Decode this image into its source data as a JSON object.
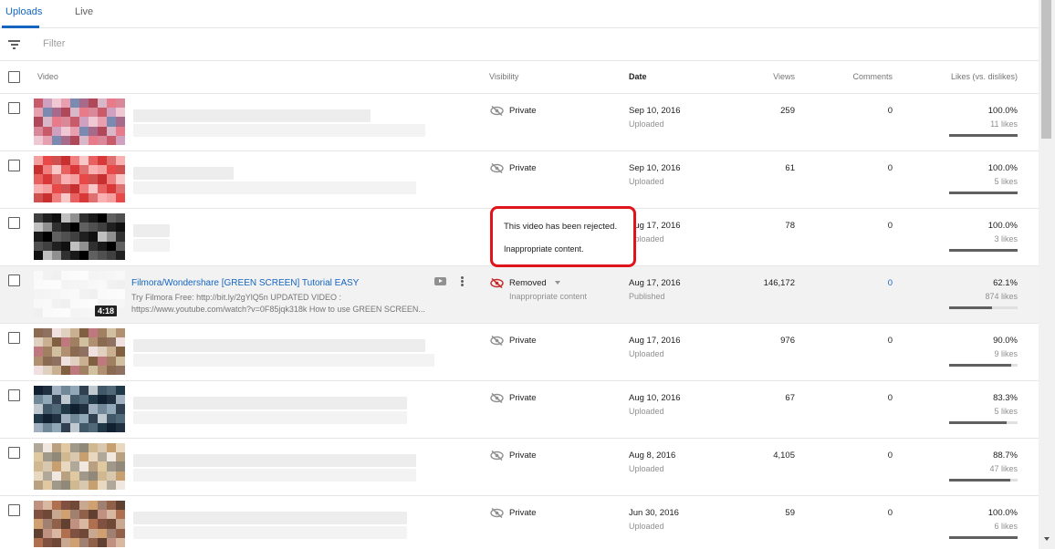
{
  "tabs": {
    "uploads": "Uploads",
    "live": "Live"
  },
  "filter": {
    "placeholder": "Filter"
  },
  "columns": {
    "video": "Video",
    "visibility": "Visibility",
    "date": "Date",
    "views": "Views",
    "comments": "Comments",
    "likes": "Likes (vs. dislikes)"
  },
  "tooltip": {
    "line1": "This video has been rejected.",
    "line2": "Inappropriate content."
  },
  "colors": {
    "accent": "#1565c0",
    "alert_border": "#e0141c",
    "removed_icon": "#c62828"
  },
  "rows": [
    {
      "visibility": "Private",
      "date": "Sep 10, 2016",
      "date_status": "Uploaded",
      "views": "259",
      "comments": "0",
      "likes_pct": "100.0%",
      "likes_count": "11 likes",
      "like_ratio": 1.0
    },
    {
      "visibility": "Private",
      "date": "Sep 10, 2016",
      "date_status": "Uploaded",
      "views": "61",
      "comments": "0",
      "likes_pct": "100.0%",
      "likes_count": "5 likes",
      "like_ratio": 1.0
    },
    {
      "visibility": "",
      "date": "Aug 17, 2016",
      "date_status": "Uploaded",
      "views": "78",
      "comments": "0",
      "likes_pct": "100.0%",
      "likes_count": "3 likes",
      "like_ratio": 1.0
    },
    {
      "title": "Filmora/Wondershare [GREEN SCREEN] Tutorial EASY",
      "description": "Try Filmora Free: http://bit.ly/2gYlQ5n UPDATED VIDEO :\nhttps://www.youtube.com/watch?v=0F85jqk318k How to use GREEN SCREEN...",
      "duration": "4:18",
      "visibility": "Removed",
      "visibility_note": "Inappropriate content",
      "date": "Aug 17, 2016",
      "date_status": "Published",
      "views": "146,172",
      "comments": "0",
      "likes_pct": "62.1%",
      "likes_count": "874 likes",
      "like_ratio": 0.621
    },
    {
      "visibility": "Private",
      "date": "Aug 17, 2016",
      "date_status": "Uploaded",
      "views": "976",
      "comments": "0",
      "likes_pct": "90.0%",
      "likes_count": "9 likes",
      "like_ratio": 0.9
    },
    {
      "visibility": "Private",
      "date": "Aug 10, 2016",
      "date_status": "Uploaded",
      "views": "67",
      "comments": "0",
      "likes_pct": "83.3%",
      "likes_count": "5 likes",
      "like_ratio": 0.833
    },
    {
      "visibility": "Private",
      "date": "Aug 8, 2016",
      "date_status": "Uploaded",
      "views": "4,105",
      "comments": "0",
      "likes_pct": "88.7%",
      "likes_count": "47 likes",
      "like_ratio": 0.887
    },
    {
      "visibility": "Private",
      "date": "Jun 30, 2016",
      "date_status": "Uploaded",
      "views": "59",
      "comments": "0",
      "likes_pct": "100.0%",
      "likes_count": "6 likes",
      "like_ratio": 1.0
    }
  ]
}
